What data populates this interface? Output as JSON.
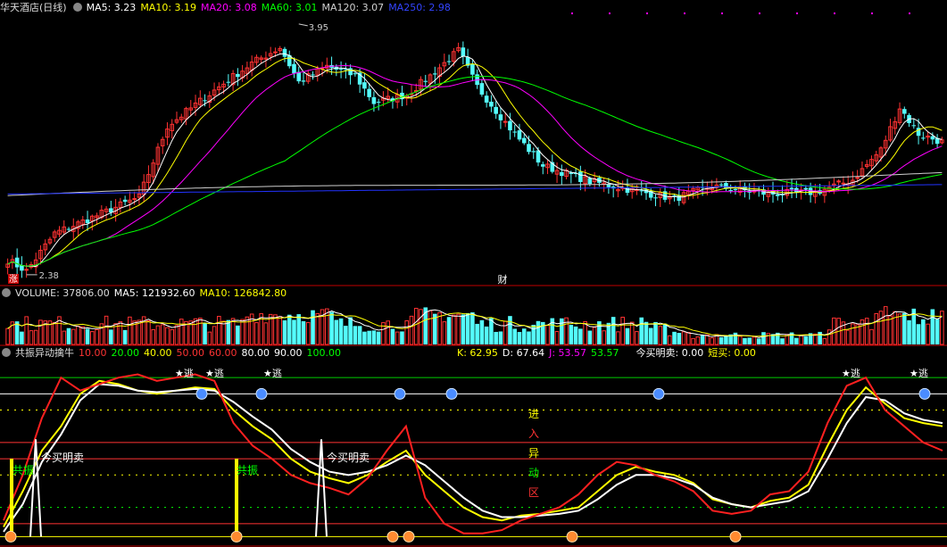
{
  "price_panel": {
    "stock_name": "华天酒店(日线)",
    "ma": [
      {
        "label": "MA5: 3.23",
        "color": "#ffffff"
      },
      {
        "label": "MA10: 3.19",
        "color": "#ffff00"
      },
      {
        "label": "MA20: 3.08",
        "color": "#ff00ff"
      },
      {
        "label": "MA60: 3.01",
        "color": "#00ff00"
      },
      {
        "label": "MA120: 3.07",
        "color": "#d0d0d0"
      },
      {
        "label": "MA250: 2.98",
        "color": "#2233ff"
      }
    ],
    "high_label": "3.95",
    "low_label": "2.38",
    "marker_zhang": "涨",
    "marker_cai": "财"
  },
  "volume_panel": {
    "label": "VOLUME: 37806.00",
    "ma5": "MA5: 121932.60",
    "ma10": "MA10: 126842.80"
  },
  "indicator_panel": {
    "name": "共振异动擒牛",
    "levels": [
      {
        "label": "10.00",
        "color": "#ff3333"
      },
      {
        "label": "20.00",
        "color": "#00ff00"
      },
      {
        "label": "40.00",
        "color": "#ffff00"
      },
      {
        "label": "50.00",
        "color": "#ff3333"
      },
      {
        "label": "60.00",
        "color": "#ff3333"
      },
      {
        "label": "80.00",
        "color": "#ffffff"
      },
      {
        "label": "90.00",
        "color": "#ffffff"
      },
      {
        "label": "100.00",
        "color": "#00ff00"
      }
    ],
    "k": "K: 62.95",
    "d": "D: 67.64",
    "j": "J: 53.57",
    "j2": "53.57",
    "buy": "今买明卖: 0.00",
    "short": "短买: 0.00",
    "escape_text": "★逃",
    "buy_text": "今买明卖",
    "resonance_text": "共振",
    "zone_chars": [
      "进",
      "入",
      "异",
      "动",
      "区"
    ]
  },
  "chart_data": [
    {
      "type": "candlestick",
      "title": "华天酒店(日线)",
      "bar_count": 200,
      "ylim": [
        2.3,
        4.0
      ],
      "anchors": [
        [
          0,
          2.45
        ],
        [
          4,
          2.38
        ],
        [
          10,
          2.62
        ],
        [
          18,
          2.72
        ],
        [
          28,
          2.85
        ],
        [
          34,
          3.3
        ],
        [
          45,
          3.55
        ],
        [
          52,
          3.7
        ],
        [
          58,
          3.8
        ],
        [
          62,
          3.58
        ],
        [
          68,
          3.68
        ],
        [
          74,
          3.62
        ],
        [
          78,
          3.45
        ],
        [
          85,
          3.5
        ],
        [
          90,
          3.62
        ],
        [
          96,
          3.78
        ],
        [
          100,
          3.55
        ],
        [
          108,
          3.25
        ],
        [
          114,
          3.05
        ],
        [
          124,
          2.95
        ],
        [
          132,
          2.9
        ],
        [
          142,
          2.84
        ],
        [
          150,
          2.92
        ],
        [
          162,
          2.87
        ],
        [
          172,
          2.88
        ],
        [
          180,
          2.96
        ],
        [
          186,
          3.15
        ],
        [
          190,
          3.42
        ],
        [
          194,
          3.25
        ],
        [
          199,
          3.2
        ]
      ],
      "high_point": {
        "x": 62,
        "y": 3.95
      },
      "low_point": {
        "x": 4,
        "y": 2.38
      },
      "ma_lags": {
        "MA5": 3,
        "MA10": 7,
        "MA20": 16,
        "MA60": 40
      }
    },
    {
      "type": "bar",
      "title": "VOLUME",
      "ylim": [
        0,
        400000
      ],
      "note": "volume bars + MA5/MA10 lines"
    },
    {
      "type": "line",
      "title": "共振异动擒牛",
      "ylim": [
        0,
        110
      ],
      "series": [
        {
          "name": "K",
          "color": "#ffff00",
          "values": [
            8,
            30,
            55,
            70,
            90,
            98,
            96,
            92,
            90,
            92,
            94,
            93,
            80,
            70,
            62,
            50,
            42,
            38,
            35,
            40,
            48,
            55,
            40,
            30,
            20,
            14,
            12,
            15,
            16,
            18,
            20,
            30,
            40,
            45,
            42,
            40,
            35,
            25,
            22,
            20,
            24,
            26,
            34,
            58,
            80,
            94,
            84,
            75,
            72,
            70
          ]
        },
        {
          "name": "D",
          "color": "#ffffff",
          "values": [
            5,
            22,
            48,
            65,
            86,
            96,
            95,
            92,
            91,
            92,
            93,
            92,
            85,
            76,
            68,
            56,
            48,
            42,
            40,
            42,
            46,
            52,
            46,
            36,
            26,
            18,
            14,
            14,
            15,
            16,
            18,
            25,
            34,
            40,
            40,
            38,
            34,
            26,
            22,
            20,
            22,
            24,
            30,
            50,
            72,
            88,
            86,
            78,
            74,
            72
          ]
        },
        {
          "name": "J",
          "color": "#ff2020",
          "values": [
            12,
            40,
            75,
            100,
            92,
            96,
            100,
            102,
            98,
            100,
            102,
            98,
            72,
            58,
            50,
            40,
            35,
            32,
            28,
            38,
            55,
            70,
            26,
            10,
            4,
            4,
            6,
            12,
            16,
            20,
            28,
            40,
            48,
            46,
            40,
            36,
            30,
            18,
            16,
            18,
            28,
            30,
            42,
            72,
            95,
            100,
            80,
            70,
            60,
            55
          ]
        }
      ]
    }
  ]
}
